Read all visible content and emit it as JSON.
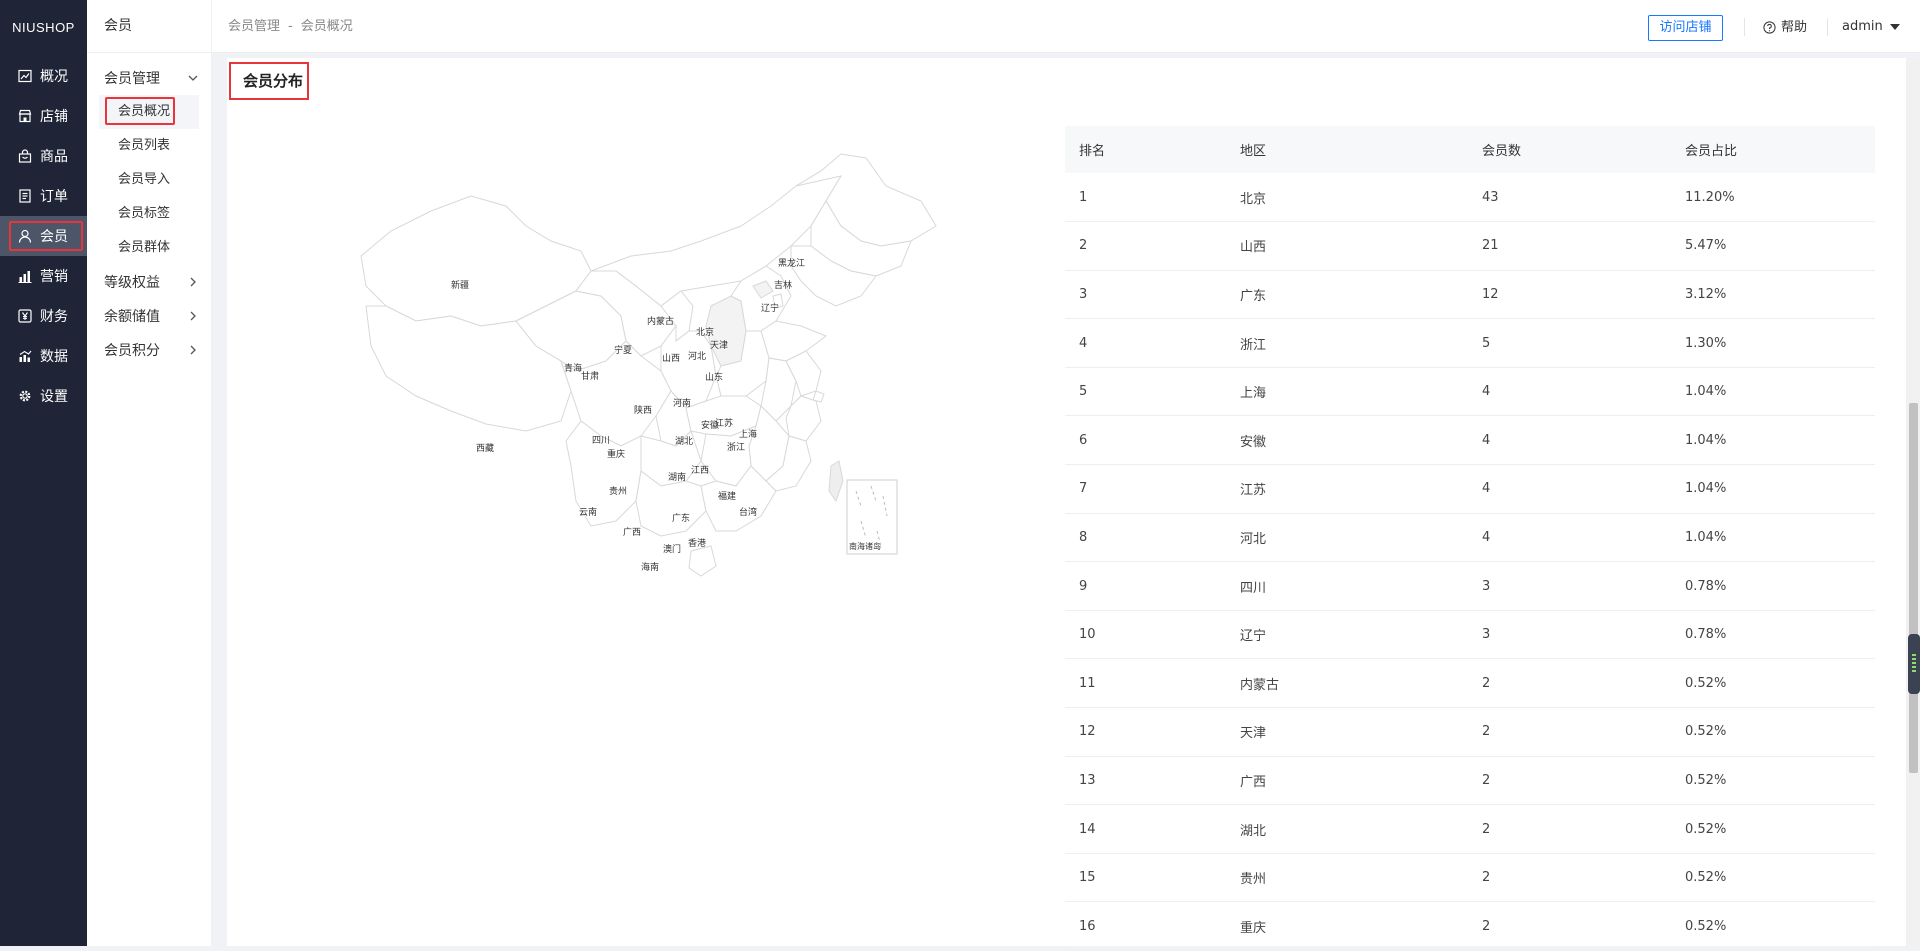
{
  "brand": "NIUSHOP",
  "nav": [
    {
      "label": "概况",
      "icon": "line-chart-icon"
    },
    {
      "label": "店铺",
      "icon": "store-icon"
    },
    {
      "label": "商品",
      "icon": "goods-bag-icon"
    },
    {
      "label": "订单",
      "icon": "order-list-icon"
    },
    {
      "label": "会员",
      "icon": "user-icon"
    },
    {
      "label": "营销",
      "icon": "bar-chart-icon"
    },
    {
      "label": "财务",
      "icon": "yen-icon"
    },
    {
      "label": "数据",
      "icon": "data-chart-icon"
    },
    {
      "label": "设置",
      "icon": "gear-icon"
    }
  ],
  "subnav": {
    "title": "会员",
    "group_manage": "会员管理",
    "items": [
      "会员概况",
      "会员列表",
      "会员导入",
      "会员标签",
      "会员群体"
    ],
    "groups": [
      "等级权益",
      "余额储值",
      "会员积分"
    ]
  },
  "topbar": {
    "crumb_1": "会员管理",
    "crumb_sep": "-",
    "crumb_2": "会员概况",
    "visit": "访问店铺",
    "help": "帮助",
    "user": "admin"
  },
  "card": {
    "title": "会员分布"
  },
  "map_labels": {
    "xinjiang": "新疆",
    "xizang": "西藏",
    "qinghai": "青海",
    "gansu": "甘肃",
    "neimenggu": "内蒙古",
    "heilongjiang": "黑龙江",
    "jilin": "吉林",
    "liaoning": "辽宁",
    "beijing": "北京",
    "tianjin": "天津",
    "hebei": "河北",
    "shanxi": "山西",
    "ningxia": "宁夏",
    "shandong": "山东",
    "henan": "河南",
    "shaanxi": "陕西",
    "sichuan": "四川",
    "chongqing": "重庆",
    "hubei": "湖北",
    "anhui": "安徽",
    "jiangsu": "江苏",
    "shanghai": "上海",
    "zhejiang": "浙江",
    "hunan": "湖南",
    "jiangxi": "江西",
    "guizhou": "贵州",
    "yunnan": "云南",
    "guangxi": "广西",
    "guangdong": "广东",
    "fujian": "福建",
    "taiwan": "台湾",
    "xianggang": "香港",
    "aomen": "澳门",
    "hainan": "海南",
    "nanhai": "南海诸岛"
  },
  "table": {
    "headers": [
      "排名",
      "地区",
      "会员数",
      "会员占比"
    ],
    "rows": [
      [
        "1",
        "北京",
        "43",
        "11.20%"
      ],
      [
        "2",
        "山西",
        "21",
        "5.47%"
      ],
      [
        "3",
        "广东",
        "12",
        "3.12%"
      ],
      [
        "4",
        "浙江",
        "5",
        "1.30%"
      ],
      [
        "5",
        "上海",
        "4",
        "1.04%"
      ],
      [
        "6",
        "安徽",
        "4",
        "1.04%"
      ],
      [
        "7",
        "江苏",
        "4",
        "1.04%"
      ],
      [
        "8",
        "河北",
        "4",
        "1.04%"
      ],
      [
        "9",
        "四川",
        "3",
        "0.78%"
      ],
      [
        "10",
        "辽宁",
        "3",
        "0.78%"
      ],
      [
        "11",
        "内蒙古",
        "2",
        "0.52%"
      ],
      [
        "12",
        "天津",
        "2",
        "0.52%"
      ],
      [
        "13",
        "广西",
        "2",
        "0.52%"
      ],
      [
        "14",
        "湖北",
        "2",
        "0.52%"
      ],
      [
        "15",
        "贵州",
        "2",
        "0.52%"
      ],
      [
        "16",
        "重庆",
        "2",
        "0.52%"
      ]
    ]
  }
}
